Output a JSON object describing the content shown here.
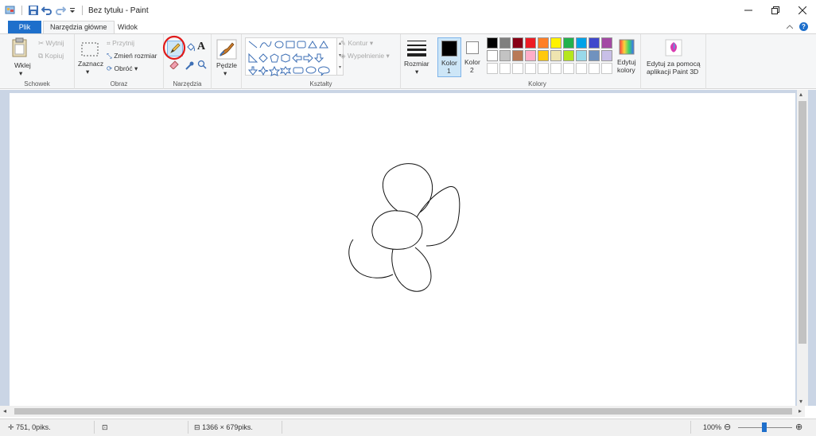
{
  "titlebar": {
    "title": "Bez tytułu - Paint",
    "window_buttons": [
      "minimize-icon",
      "restore-icon",
      "close-icon"
    ]
  },
  "tabs": {
    "file": "Plik",
    "home": "Narzędzia główne",
    "view": "Widok"
  },
  "ribbon": {
    "clipboard": {
      "label": "Schowek",
      "paste": "Wklej",
      "cut": "Wytnij",
      "copy": "Kopiuj"
    },
    "image": {
      "label": "Obraz",
      "select": "Zaznacz",
      "crop": "Przytnij",
      "resize": "Zmień rozmiar",
      "rotate": "Obróć"
    },
    "tools": {
      "label": "Narzędzia",
      "text_tool": "A"
    },
    "brushes": {
      "label": "Pędzle"
    },
    "shapes": {
      "label": "Kształty",
      "outline": "Kontur",
      "fill": "Wypełnienie"
    },
    "size": {
      "label": "Rozmiar"
    },
    "colors": {
      "label": "Kolory",
      "color1": "Kolor",
      "color1_num": "1",
      "color2": "Kolor",
      "color2_num": "2",
      "edit_colors_1": "Edytuj",
      "edit_colors_2": "kolory",
      "palette_row1": [
        "#000000",
        "#7f7f7f",
        "#880015",
        "#ed1c24",
        "#ff7f27",
        "#fff200",
        "#22b14c",
        "#00a2e8",
        "#3f48cc",
        "#a349a4"
      ],
      "palette_row2": [
        "#ffffff",
        "#c3c3c3",
        "#b97a57",
        "#ffaec9",
        "#ffc90e",
        "#efe4b0",
        "#b5e61d",
        "#99d9ea",
        "#7092be",
        "#c8bfe7"
      ]
    },
    "paint3d": {
      "line1": "Edytuj za pomocą",
      "line2": "aplikacji Paint 3D"
    }
  },
  "statusbar": {
    "cursor_pos": "751, 0piks.",
    "image_size": "1366 × 679piks.",
    "zoom": "100%"
  },
  "accent": "#1e6fcb",
  "highlight_circle": "#e01b1b"
}
